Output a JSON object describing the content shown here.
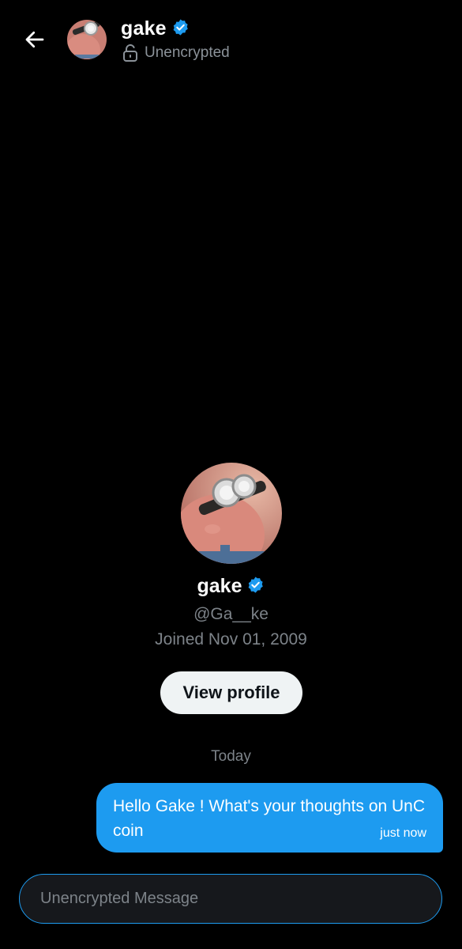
{
  "header": {
    "name": "gake",
    "status": "Unencrypted"
  },
  "profile": {
    "name": "gake",
    "handle": "@Ga__ke",
    "joined": "Joined Nov 01, 2009",
    "view_profile_label": "View profile"
  },
  "conversation": {
    "date_divider": "Today",
    "messages": [
      {
        "text": "Hello Gake ! What's your thoughts on UnC coin",
        "time": "just now",
        "from_me": true
      }
    ]
  },
  "composer": {
    "placeholder": "Unencrypted Message",
    "value": ""
  },
  "icons": {
    "back": "arrow-left-icon",
    "verified": "verified-badge-icon",
    "lock": "unlocked-padlock-icon"
  },
  "colors": {
    "accent": "#1d9bf0",
    "background": "#000000",
    "secondary_text": "#7d8389"
  }
}
